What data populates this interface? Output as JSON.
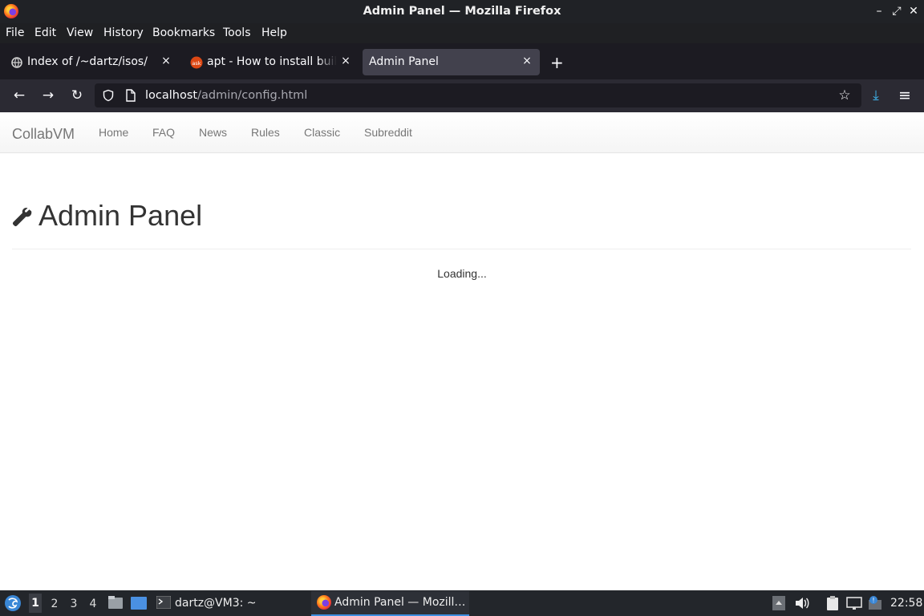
{
  "window": {
    "title": "Admin Panel — Mozilla Firefox",
    "controls": [
      "–",
      "⤢",
      "✕"
    ]
  },
  "menubar": {
    "items": [
      {
        "label": "File"
      },
      {
        "label": "Edit"
      },
      {
        "label": "View"
      },
      {
        "label": "History"
      },
      {
        "label": "Bookmarks"
      },
      {
        "label": "Tools"
      },
      {
        "label": "Help"
      }
    ]
  },
  "tabs": [
    {
      "label": "Index of /~dartz/isos/",
      "favicon": "globe-icon",
      "active": false
    },
    {
      "label": "apt - How to install build-",
      "favicon": "askubuntu-icon",
      "active": false
    },
    {
      "label": "Admin Panel",
      "favicon": "",
      "active": true
    }
  ],
  "tabbar": {
    "new_tab": "+",
    "close": "×"
  },
  "navbar": {
    "back": "←",
    "forward": "→",
    "reload": "↻",
    "url_host": "localhost",
    "url_path": "/admin/config.html",
    "bookmark": "☆",
    "download": "⤓",
    "menu": "≡"
  },
  "page": {
    "brand": "CollabVM",
    "nav": [
      "Home",
      "FAQ",
      "News",
      "Rules",
      "Classic",
      "Subreddit"
    ],
    "title": "Admin Panel",
    "title_icon": "wrench-icon",
    "status": "Loading..."
  },
  "taskbar": {
    "workspaces": [
      "1",
      "2",
      "3",
      "4"
    ],
    "active_workspace": "1",
    "terminal_label": "dartz@VM3: ~",
    "firefox_label": "Admin Panel — Mozill…",
    "clock": "22:58"
  },
  "colors": {
    "accent_download": "#3fb7f0",
    "active_task_underline": "#3d8ee0"
  }
}
